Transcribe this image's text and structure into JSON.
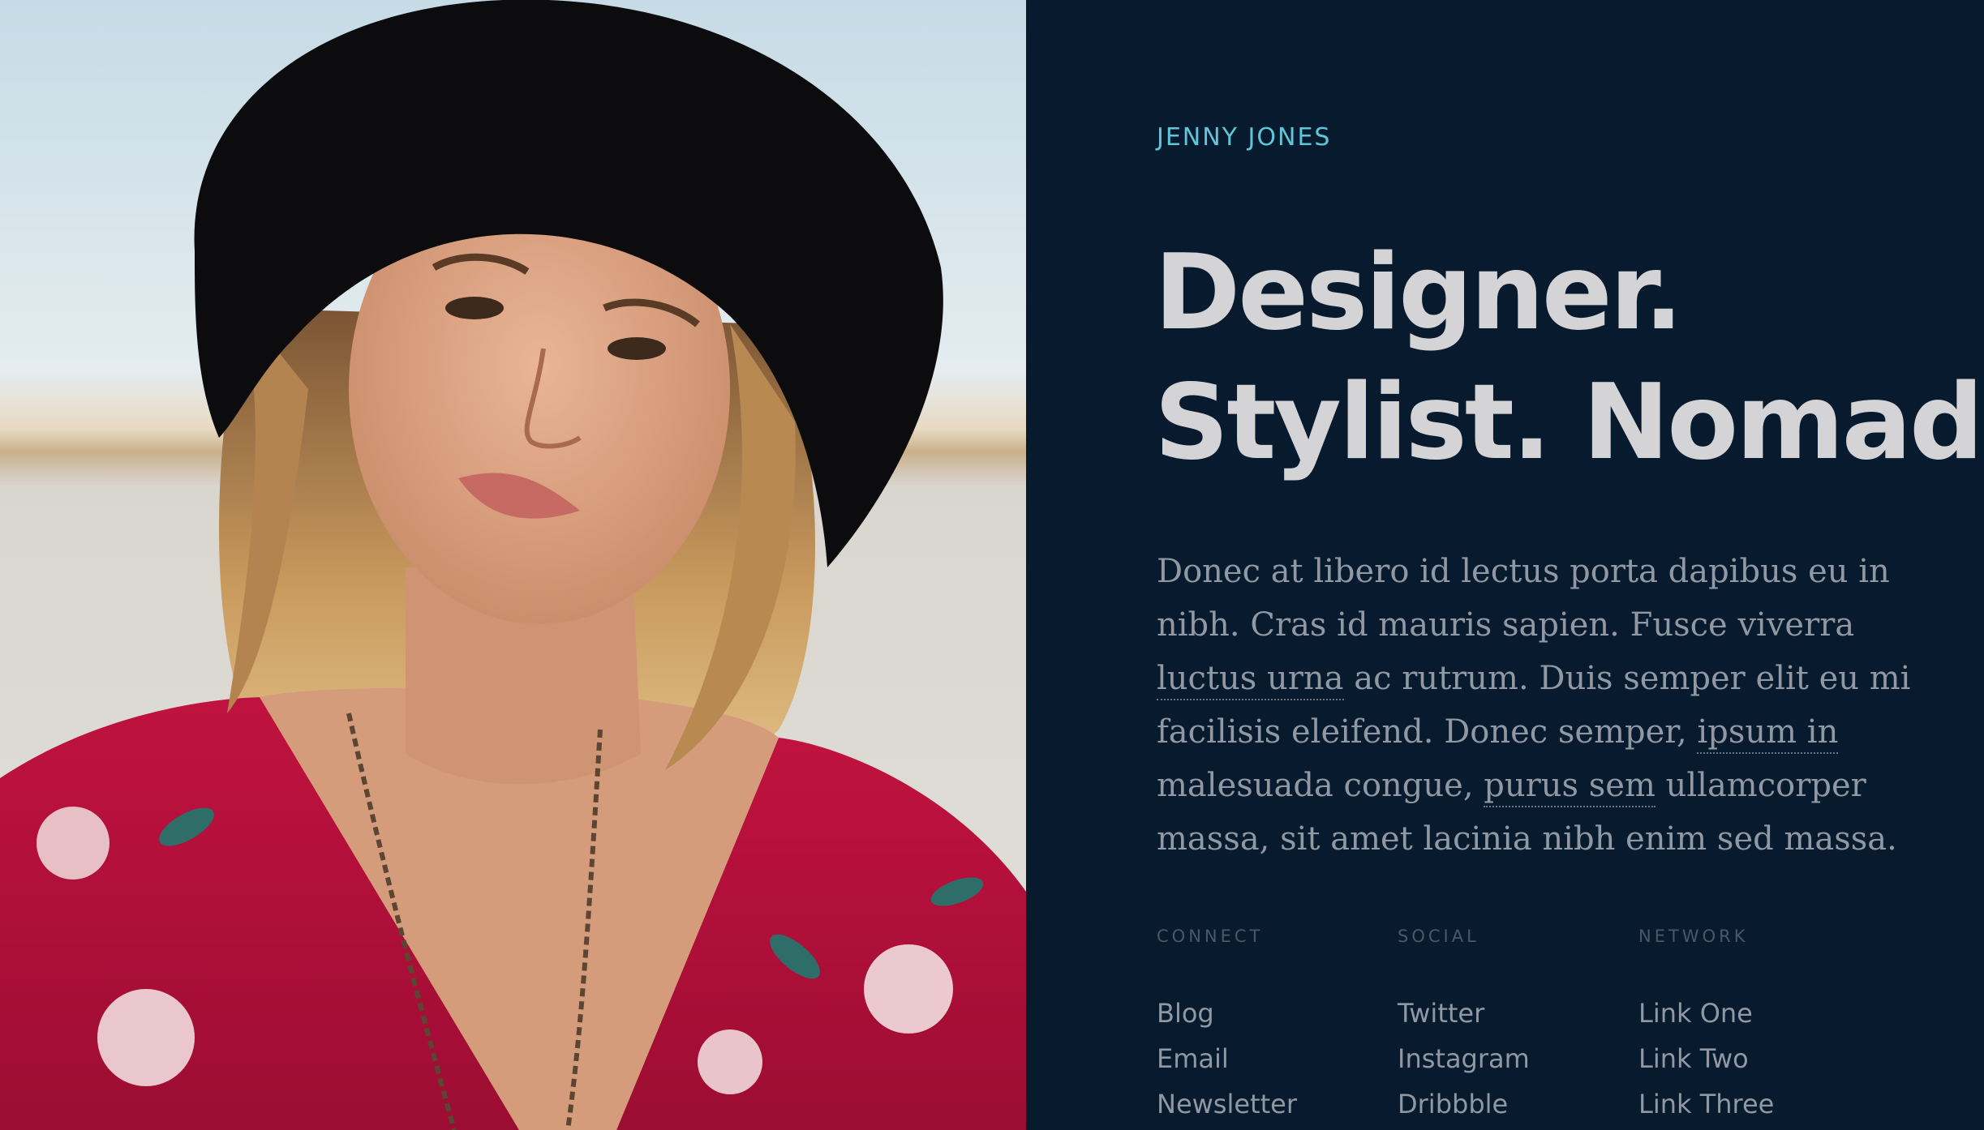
{
  "photo": {
    "alt_subject": "portrait-photo"
  },
  "brand": {
    "name": "JENNY JONES"
  },
  "headline": {
    "line1": "Designer.",
    "line2": "Stylist. Nomad."
  },
  "intro": {
    "part1": "Donec at libero id lectus porta dapibus eu in nibh. Cras id mauris sapien. Fusce viverra ",
    "link1": "luctus urna",
    "part2": " ac rutrum. Duis semper elit eu mi facilisis eleifend. Donec semper, ",
    "link2": "ipsum in",
    "part3": " malesuada congue, ",
    "link3": "purus sem",
    "part4": " ullamcorper massa, sit amet lacinia nibh enim sed massa."
  },
  "columns": [
    {
      "title": "CONNECT",
      "links": [
        "Blog",
        "Email",
        "Newsletter"
      ]
    },
    {
      "title": "SOCIAL",
      "links": [
        "Twitter",
        "Instagram",
        "Dribbble"
      ]
    },
    {
      "title": "NETWORK",
      "links": [
        "Link One",
        "Link Two",
        "Link Three"
      ]
    }
  ],
  "colors": {
    "background": "#081a2e",
    "accent": "#5ec6d8",
    "headline": "#d4d4d6",
    "body": "#8f98a3",
    "muted": "#4a5767"
  }
}
